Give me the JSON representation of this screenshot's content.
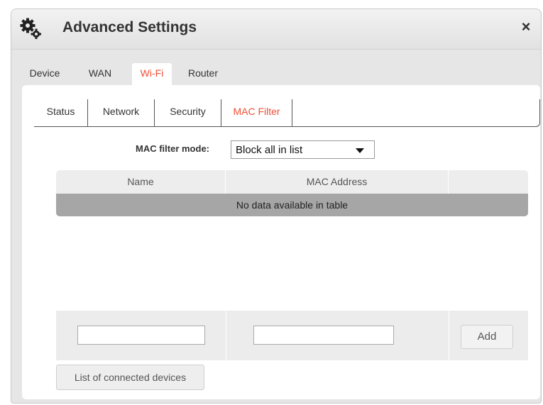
{
  "dialog": {
    "title": "Advanced Settings",
    "close_label": "×",
    "icon": "gears-icon"
  },
  "main_tabs": [
    {
      "label": "Device",
      "active": false
    },
    {
      "label": "WAN",
      "active": false
    },
    {
      "label": "Wi-Fi",
      "active": true
    },
    {
      "label": "Router",
      "active": false
    }
  ],
  "sub_tabs": [
    {
      "label": "Status",
      "active": false
    },
    {
      "label": "Network",
      "active": false
    },
    {
      "label": "Security",
      "active": false
    },
    {
      "label": "MAC Filter",
      "active": true
    }
  ],
  "mac_filter": {
    "mode_label": "MAC filter mode:",
    "mode_value": "Block all in list"
  },
  "table": {
    "columns": [
      "Name",
      "MAC Address",
      ""
    ],
    "empty_message": "No data available in table"
  },
  "inputs": {
    "name_value": "",
    "mac_value": "",
    "add_label": "Add"
  },
  "connected_devices_label": "List of connected devices",
  "colors": {
    "accent": "#f04e35",
    "dialog_bg": "#e6e6e6",
    "empty_row_bg": "#a6a6a6"
  }
}
